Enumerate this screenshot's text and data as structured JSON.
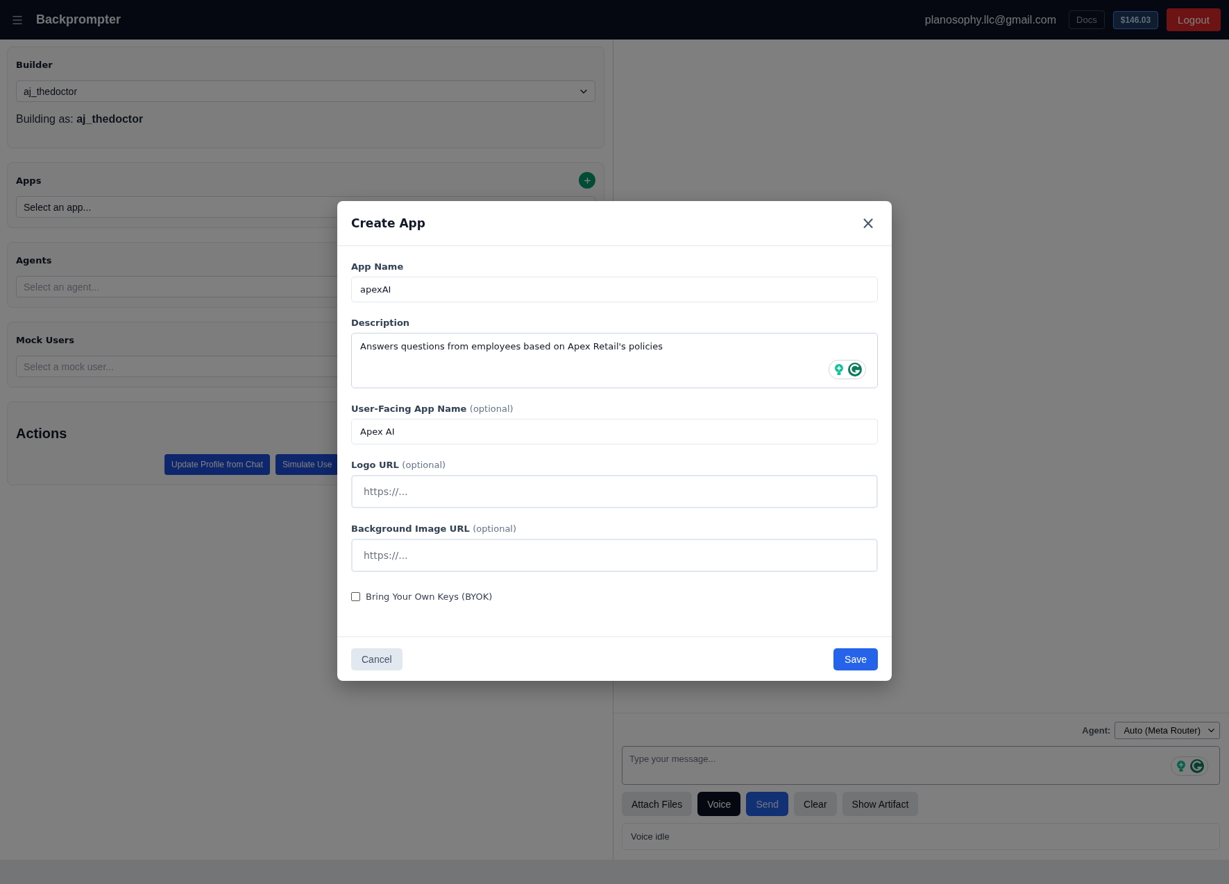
{
  "header": {
    "title": "Backprompter",
    "email": "planosophy.llc@gmail.com",
    "docs": "Docs",
    "balance": "$146.03",
    "logout": "Logout"
  },
  "panels": [
    {
      "title": "Builder",
      "value": "aj_thedoctor",
      "disabled": false,
      "note": "Building as: **aj_thedoctor**"
    },
    {
      "title": "Apps",
      "placeholder": "Select an app...",
      "disabled": false,
      "add": true
    },
    {
      "title": "Agents",
      "placeholder": "Select an agent...",
      "disabled": true
    },
    {
      "title": "Mock Users",
      "placeholder": "Select a mock user...",
      "disabled": true
    }
  ],
  "actions": {
    "title": "Actions",
    "buttons": [
      "Update Profile from Chat",
      "Simulate Use"
    ]
  },
  "chat": {
    "agent_label": "Agent:",
    "agent_value": "Auto (Meta Router)",
    "placeholder": "Type your message...",
    "buttons": [
      {
        "label": "Attach Files",
        "kind": "secondary"
      },
      {
        "label": "Voice",
        "kind": "dark"
      },
      {
        "label": "Send",
        "kind": "primary"
      },
      {
        "label": "Clear",
        "kind": "secondary"
      },
      {
        "label": "Show Artifact",
        "kind": "secondary"
      }
    ],
    "status": "Voice idle"
  },
  "modal": {
    "title": "Create App",
    "close": "×",
    "fields": [
      {
        "label": "App Name",
        "kind": "input",
        "value": "apexAI"
      },
      {
        "label": "Description",
        "kind": "textarea",
        "value": "Answers questions from employees based on Apex Retail's policies"
      },
      {
        "label": "User-Facing App Name",
        "hint": "(optional)",
        "kind": "input",
        "value": "Apex AI"
      },
      {
        "label": "Logo URL",
        "hint": "(optional)",
        "kind": "url",
        "placeholder": "https://..."
      },
      {
        "label": "Background Image URL",
        "hint": "(optional)",
        "kind": "url",
        "placeholder": "https://..."
      }
    ],
    "checkbox": {
      "label": "Bring Your Own Keys (BYOK)",
      "checked": false
    },
    "cancel": "Cancel",
    "save": "Save"
  }
}
